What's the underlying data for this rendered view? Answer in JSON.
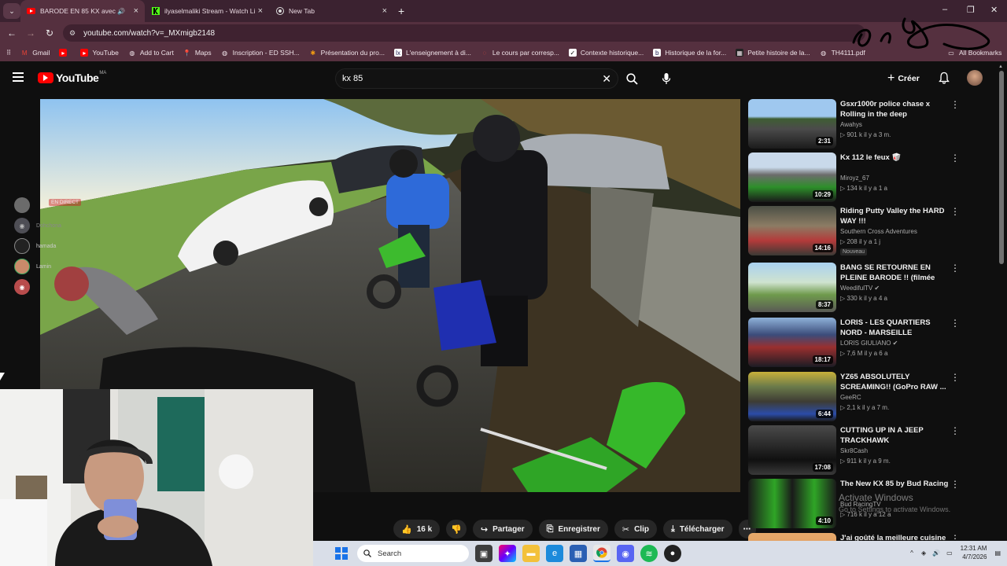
{
  "browser": {
    "tabs": [
      {
        "title": "BARODE EN 85 KX avec TOU",
        "active": true
      },
      {
        "title": "ilyaselmaliki Stream - Watch Li...",
        "active": false
      },
      {
        "title": "New Tab",
        "active": false
      }
    ],
    "url": "youtube.com/watch?v=_MXmigb2148",
    "bookmarks": [
      "Gmail",
      "YouTube",
      "Add to Cart",
      "Maps",
      "Inscription - ED SSH...",
      "Présentation du pro...",
      "L'enseignement à di...",
      "Le cours par corresp...",
      "Contexte historique...",
      "Historique de la for...",
      "Petite histoire de la...",
      "TH4111.pdf",
      "All Bookmarks"
    ]
  },
  "youtube": {
    "logo_text": "YouTube",
    "country_code": "MA",
    "search_query": "kx 85",
    "create_label": "Créer"
  },
  "overlay": {
    "live_label": "EN DIRECT",
    "users": [
      "Dohchona",
      "hamada",
      "Lamin"
    ]
  },
  "actions": {
    "likes": "16 k",
    "share": "Partager",
    "save": "Enregistrer",
    "clip": "Clip",
    "download": "Télécharger"
  },
  "recommendations": [
    {
      "title": "Gsxr1000r police chase x Rolling in the deep",
      "channel": "Awahys",
      "meta": "▷ 901 k  il y a 3 m.",
      "duration": "2:31"
    },
    {
      "title": "Kx 112 le feux 🥡",
      "channel": "Miroyz_67",
      "meta": "▷ 134 k  il y a 1 a",
      "duration": "10:29"
    },
    {
      "title": "Riding Putty Valley the HARD WAY !!!",
      "channel": "Southern Cross Adventures",
      "meta": "▷ 208  il y a 1 j",
      "duration": "14:16",
      "badge": "Nouveau"
    },
    {
      "title": "BANG SE RETOURNE EN PLEINE BARODE !! (filmée bien...",
      "channel": "WeedifulTV ✔",
      "meta": "▷ 330 k  il y a 4 a",
      "duration": "8:37"
    },
    {
      "title": "LORIS - LES QUARTIERS NORD - MARSEILLE",
      "channel": "LORIS GIULIANO ✔",
      "meta": "▷ 7,6 M  il y a 6 a",
      "duration": "18:17"
    },
    {
      "title": "YZ65 ABSOLUTELY SCREAMING!! (GoPro RAW ...",
      "channel": "GeeRC",
      "meta": "▷ 2,1 k  il y a 7 m.",
      "duration": "6:44"
    },
    {
      "title": "CUTTING UP IN A JEEP TRACKHAWK",
      "channel": "Skr8Cash",
      "meta": "▷ 911 k  il y a 9 m.",
      "duration": "17:08"
    },
    {
      "title": "The New KX 85 by Bud Racing",
      "channel": "Bud RacingTV",
      "meta": "▷ 716 k  il y a 12 a",
      "duration": "4:10"
    },
    {
      "title": "J'ai goûté la meilleure cuisine",
      "channel": "",
      "meta": "",
      "duration": ""
    }
  ],
  "watermark": {
    "line1": "Activate Windows",
    "line2": "Go to Settings to activate Windows."
  },
  "taskbar": {
    "search_placeholder": "Search",
    "time": "12:31 AM",
    "date": "4/7/2026"
  }
}
